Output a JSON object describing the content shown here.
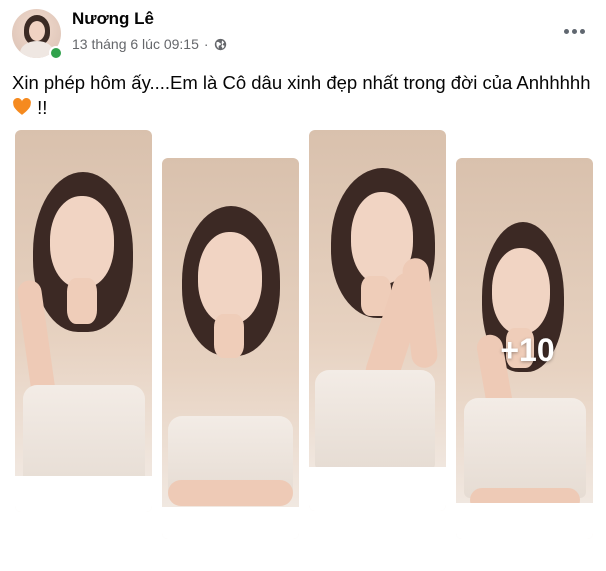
{
  "post": {
    "author": "Nương Lê",
    "timestamp": "13 tháng 6 lúc 09:15",
    "separator": "·",
    "privacy_icon": "globe-icon",
    "more_icon": "more-options-icon",
    "online": true,
    "caption_text": "Xin phép hôm ấy....Em là Cô dâu xinh đẹp nhất trong đời của Anhhhhh",
    "caption_emoji": "orange-heart",
    "caption_suffix": "!!"
  },
  "gallery": {
    "photos": [
      {
        "alt": "bride-photo-1"
      },
      {
        "alt": "bride-photo-2"
      },
      {
        "alt": "bride-photo-3"
      },
      {
        "alt": "bride-photo-4"
      }
    ],
    "more_count_label": "+10"
  },
  "colors": {
    "online": "#31a24c",
    "secondary_text": "#65676b",
    "heart": "#f58a1f"
  }
}
